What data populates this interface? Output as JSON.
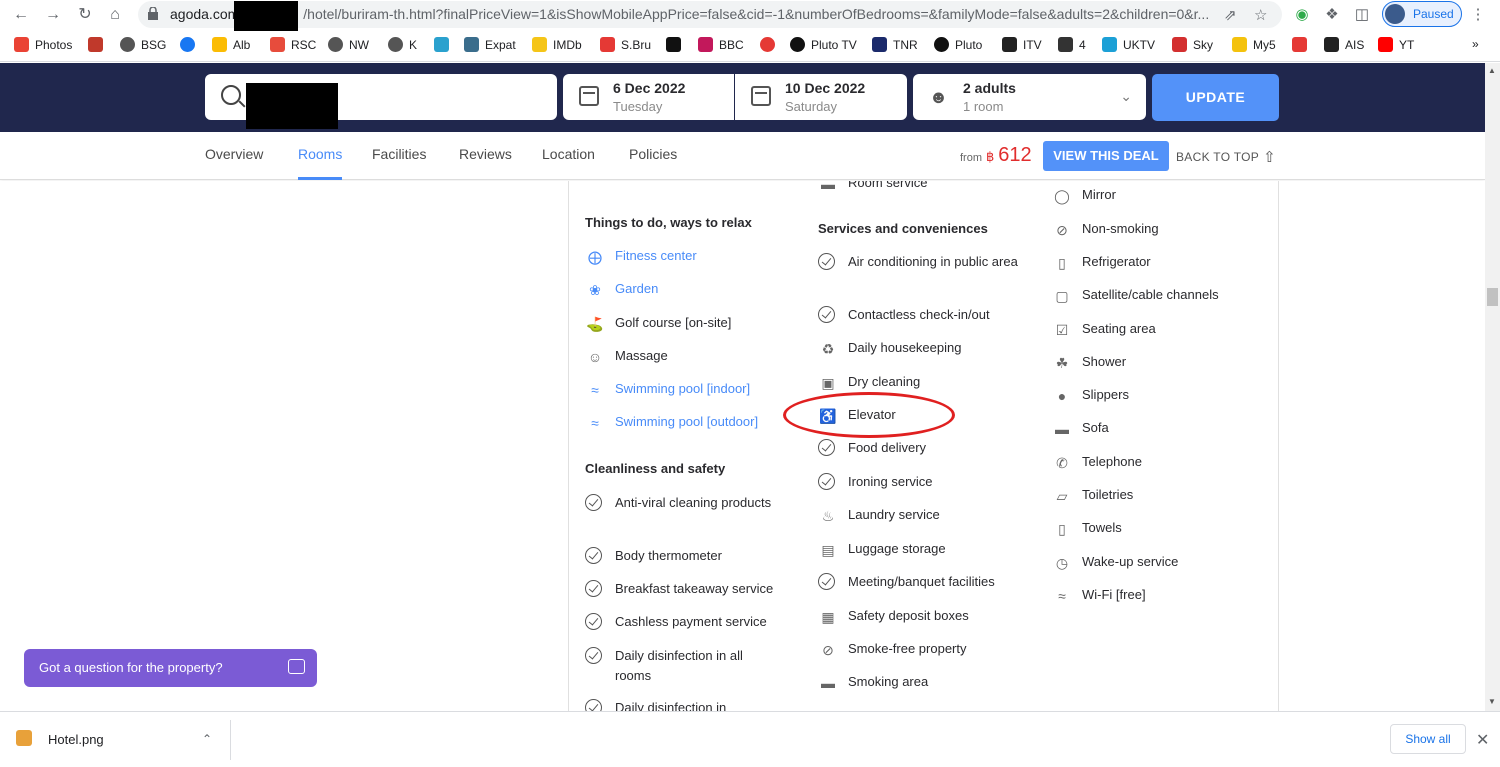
{
  "browser": {
    "url_host": "agoda.com",
    "url_path": "/hotel/buriram-th.html?finalPriceView=1&isShowMobileAppPrice=false&cid=-1&numberOfBedrooms=&familyMode=false&adults=2&children=0&r...",
    "profile_status": "Paused",
    "bookmarks": [
      "Photos",
      "BSG",
      "Alb",
      "RSC",
      "NW",
      "K",
      "Expat",
      "IMDb",
      "S.Bru",
      "BBC",
      "Pluto TV",
      "TNR",
      "Pluto",
      "ITV",
      "4",
      "UKTV",
      "Sky",
      "My5",
      "AIS",
      "YT"
    ],
    "bookmark_more": "»"
  },
  "search": {
    "checkin_date": "6 Dec 2022",
    "checkin_day": "Tuesday",
    "checkout_date": "10 Dec 2022",
    "checkout_day": "Saturday",
    "guests": "2 adults",
    "rooms": "1 room",
    "update_label": "UPDATE"
  },
  "tabs": [
    "Overview",
    "Rooms",
    "Facilities",
    "Reviews",
    "Location",
    "Policies"
  ],
  "price": {
    "from_label": "from",
    "currency": "฿",
    "amount": "612",
    "deal_label": "VIEW THIS DEAL",
    "back_to_top": "BACK TO TOP"
  },
  "facilities": {
    "col1": {
      "section1_title": "Things to do, ways to relax",
      "section1_items": [
        "Fitness center",
        "Garden",
        "Golf course [on-site]",
        "Massage",
        "Swimming pool [indoor]",
        "Swimming pool [outdoor]"
      ],
      "section2_title": "Cleanliness and safety",
      "section2_items": [
        "Anti-viral cleaning products",
        "Body thermometer",
        "Breakfast takeaway service",
        "Cashless payment service",
        "Daily disinfection in all rooms",
        "Daily disinfection in"
      ]
    },
    "col2": {
      "top_item": "Room service",
      "section_title": "Services and conveniences",
      "items": [
        "Air conditioning in public area",
        "Contactless check-in/out",
        "Daily housekeeping",
        "Dry cleaning",
        "Elevator",
        "Food delivery",
        "Ironing service",
        "Laundry service",
        "Luggage storage",
        "Meeting/banquet facilities",
        "Safety deposit boxes",
        "Smoke-free property",
        "Smoking area"
      ]
    },
    "col3": {
      "items": [
        "Mirror",
        "Non-smoking",
        "Refrigerator",
        "Satellite/cable channels",
        "Seating area",
        "Shower",
        "Slippers",
        "Sofa",
        "Telephone",
        "Toiletries",
        "Towels",
        "Wake-up service",
        "Wi-Fi [free]"
      ]
    }
  },
  "chat": {
    "label": "Got a question for the property?"
  },
  "downloads": {
    "file": "Hotel.png",
    "show_all": "Show all"
  }
}
